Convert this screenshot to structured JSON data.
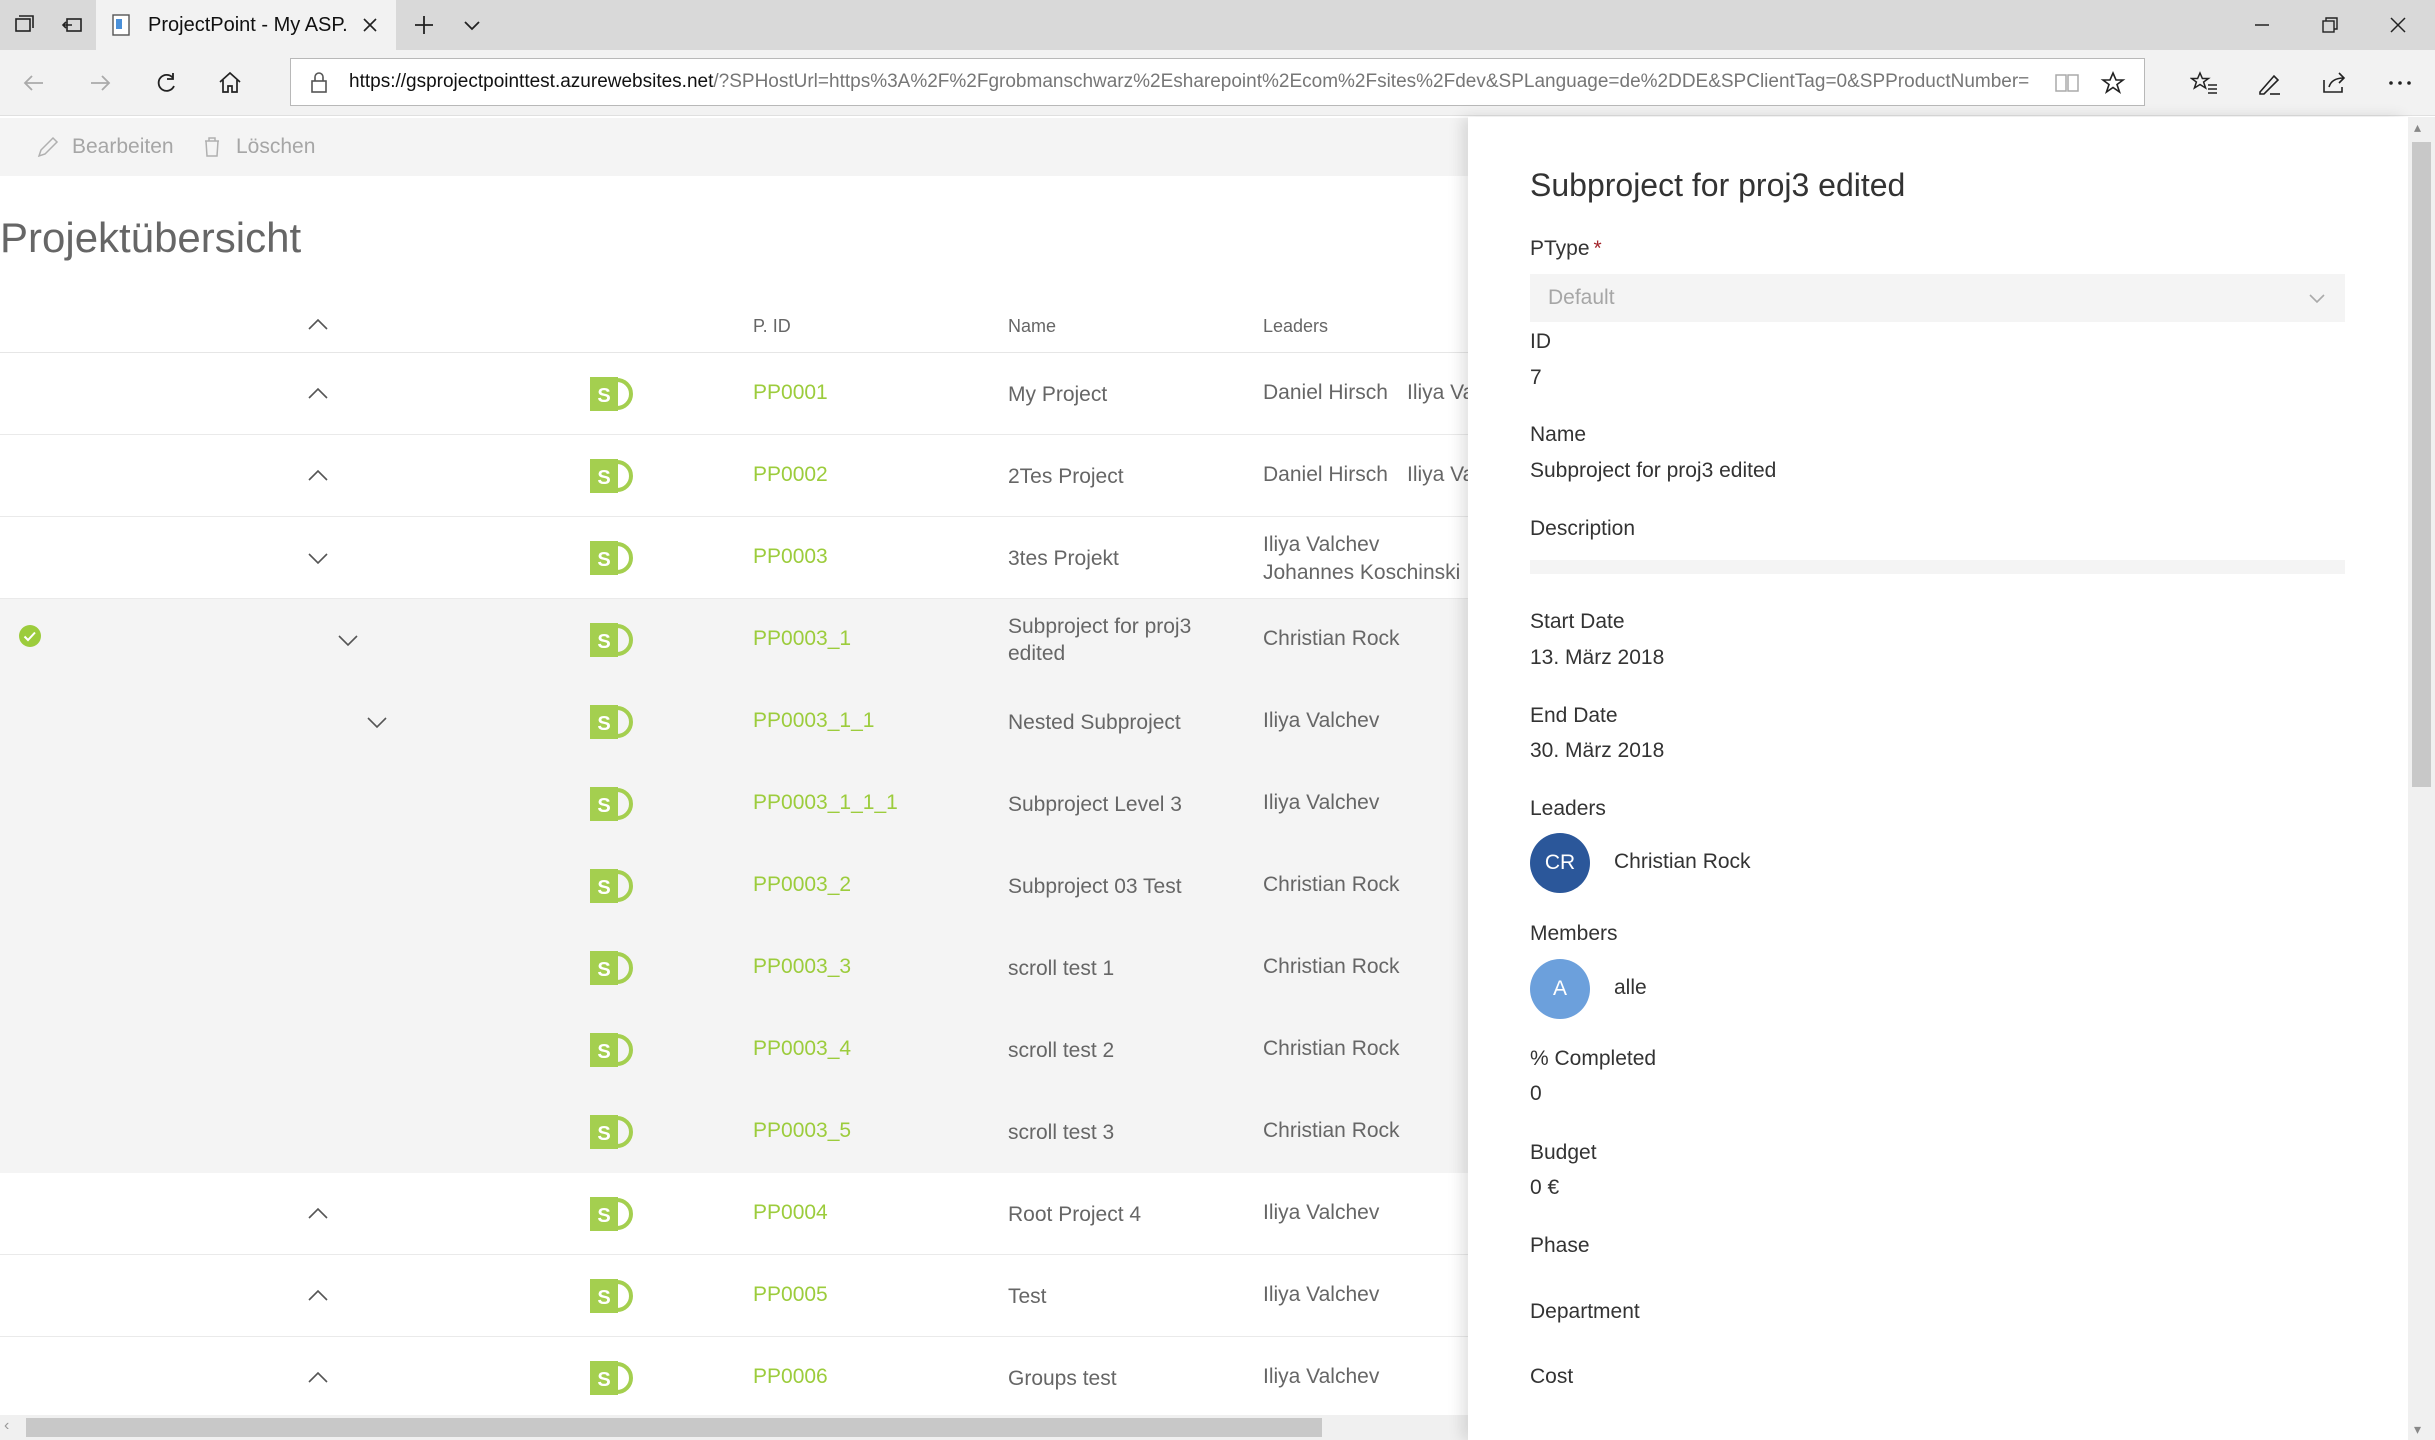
{
  "browser": {
    "tab_title": "ProjectPoint - My ASP.N",
    "url_host": "https://gsprojectpointtest.azurewebsites.net",
    "url_rest": "/?SPHostUrl=https%3A%2F%2Fgrobmanschwarz%2Esharepoint%2Ecom%2Fsites%2Fdev&SPLanguage=de%2DDE&SPClientTag=0&SPProductNumber="
  },
  "commandbar": {
    "edit_label": "Bearbeiten",
    "delete_label": "Löschen"
  },
  "page": {
    "title": "Projektübersicht"
  },
  "list": {
    "columns": {
      "pid": "P. ID",
      "name": "Name",
      "leaders": "Leaders"
    },
    "rows": [
      {
        "pid": "PP0001",
        "name": "My Project",
        "leaders": "Daniel Hirsch",
        "leaders2": "Iliya Va"
      },
      {
        "pid": "PP0002",
        "name": "2Tes Project",
        "leaders": "Daniel Hirsch",
        "leaders2": "Iliya Va"
      },
      {
        "pid": "PP0003",
        "name": "3tes Projekt",
        "leaders": "Iliya Valchev",
        "leaders2": "Johannes Koschinski"
      },
      {
        "pid": "PP0003_1",
        "name": "Subproject for proj3 edited",
        "leaders": "Christian Rock"
      },
      {
        "pid": "PP0003_1_1",
        "name": "Nested Subproject",
        "leaders": "Iliya Valchev"
      },
      {
        "pid": "PP0003_1_1_1",
        "name": "Subproject Level 3",
        "leaders": "Iliya Valchev"
      },
      {
        "pid": "PP0003_2",
        "name": "Subproject 03 Test",
        "leaders": "Christian Rock"
      },
      {
        "pid": "PP0003_3",
        "name": "scroll test 1",
        "leaders": "Christian Rock"
      },
      {
        "pid": "PP0003_4",
        "name": "scroll test 2",
        "leaders": "Christian Rock"
      },
      {
        "pid": "PP0003_5",
        "name": "scroll test 3",
        "leaders": "Christian Rock"
      },
      {
        "pid": "PP0004",
        "name": "Root Project 4",
        "leaders": "Iliya Valchev"
      },
      {
        "pid": "PP0005",
        "name": "Test",
        "leaders": "Iliya Valchev"
      },
      {
        "pid": "PP0006",
        "name": "Groups test",
        "leaders": "Iliya Valchev"
      }
    ]
  },
  "panel": {
    "title": "Subproject for proj3 edited",
    "ptype_label": "PType",
    "ptype_required": "*",
    "ptype_value": "Default",
    "id_label": "ID",
    "id_value": "7",
    "name_label": "Name",
    "name_value": "Subproject for proj3 edited",
    "description_label": "Description",
    "start_label": "Start Date",
    "start_value": "13. März 2018",
    "end_label": "End Date",
    "end_value": "30. März 2018",
    "leaders_label": "Leaders",
    "leader_initials": "CR",
    "leader_name": "Christian Rock",
    "members_label": "Members",
    "member_initials": "A",
    "member_name": "alle",
    "completed_label": "% Completed",
    "completed_value": "0",
    "budget_label": "Budget",
    "budget_value": "0 €",
    "phase_label": "Phase",
    "department_label": "Department",
    "cost_label": "Cost"
  },
  "colors": {
    "accent_green": "#9ccc3c",
    "leader_avatar": "#2b579a",
    "member_avatar": "#6ca0dc",
    "required": "#a4262c"
  }
}
